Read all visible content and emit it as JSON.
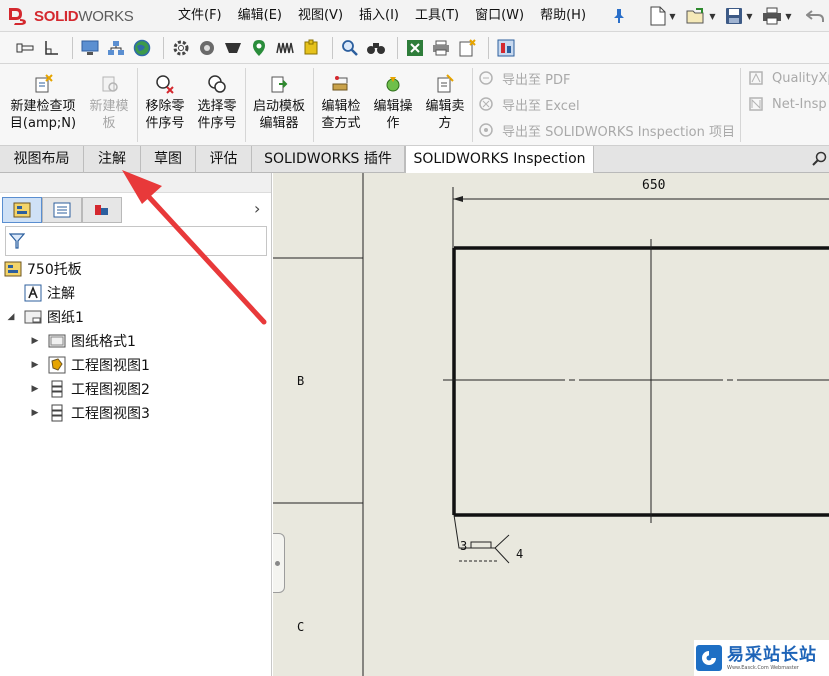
{
  "app": {
    "logo_text_ds": "3S",
    "logo_text_solid": "SOLID",
    "logo_text_works": "WORKS",
    "brand_color": "#d4282e"
  },
  "menu": {
    "items": [
      "文件(F)",
      "编辑(E)",
      "视图(V)",
      "插入(I)",
      "工具(T)",
      "窗口(W)",
      "帮助(H)"
    ]
  },
  "ribbon": {
    "buttons": [
      {
        "label": "新建检查项\n目(amp;N)",
        "enabled": true,
        "icon": "new-inspection-icon"
      },
      {
        "label": "新建模\n板",
        "enabled": false,
        "icon": "new-template-icon"
      },
      {
        "label": "移除零\n件序号",
        "enabled": true,
        "icon": "remove-balloon-icon"
      },
      {
        "label": "选择零\n件序号",
        "enabled": true,
        "icon": "select-balloon-icon"
      },
      {
        "label": "启动模板\n编辑器",
        "enabled": true,
        "icon": "template-editor-icon"
      },
      {
        "label": "编辑检\n查方式",
        "enabled": true,
        "icon": "edit-method-icon"
      },
      {
        "label": "编辑操\n作",
        "enabled": true,
        "icon": "edit-operation-icon"
      },
      {
        "label": "编辑卖\n方",
        "enabled": true,
        "icon": "edit-vendor-icon"
      }
    ],
    "export_items": [
      {
        "label": "导出至 PDF",
        "icon": "export-pdf-icon"
      },
      {
        "label": "导出至 Excel",
        "icon": "export-excel-icon"
      },
      {
        "label": "导出至 SOLIDWORKS Inspection 项目",
        "icon": "export-project-icon"
      }
    ],
    "extra_items": [
      {
        "label": "QualityXp",
        "icon": "qualityxpert-icon"
      },
      {
        "label": "Net-Insp",
        "icon": "net-inspect-icon"
      }
    ]
  },
  "tabs": {
    "items": [
      "视图布局",
      "注解",
      "草图",
      "评估",
      "SOLIDWORKS 插件",
      "SOLIDWORKS Inspection"
    ],
    "active_index": 5
  },
  "tree": {
    "root": "750托板",
    "annotations": "注解",
    "sheet": "图纸1",
    "sheet_children": [
      "图纸格式1",
      "工程图视图1",
      "工程图视图2",
      "工程图视图3"
    ]
  },
  "drawing": {
    "zone_b": "B",
    "zone_c": "C",
    "dimension": "650",
    "weld_note_3": "3",
    "weld_note_4": "4",
    "sheet_color": "#e9e8de"
  },
  "watermark": {
    "title": "易采站长站",
    "subtitle": "Www.Easck.Com Webmaster"
  },
  "overlay": {
    "arrow_color": "#e8393a"
  }
}
